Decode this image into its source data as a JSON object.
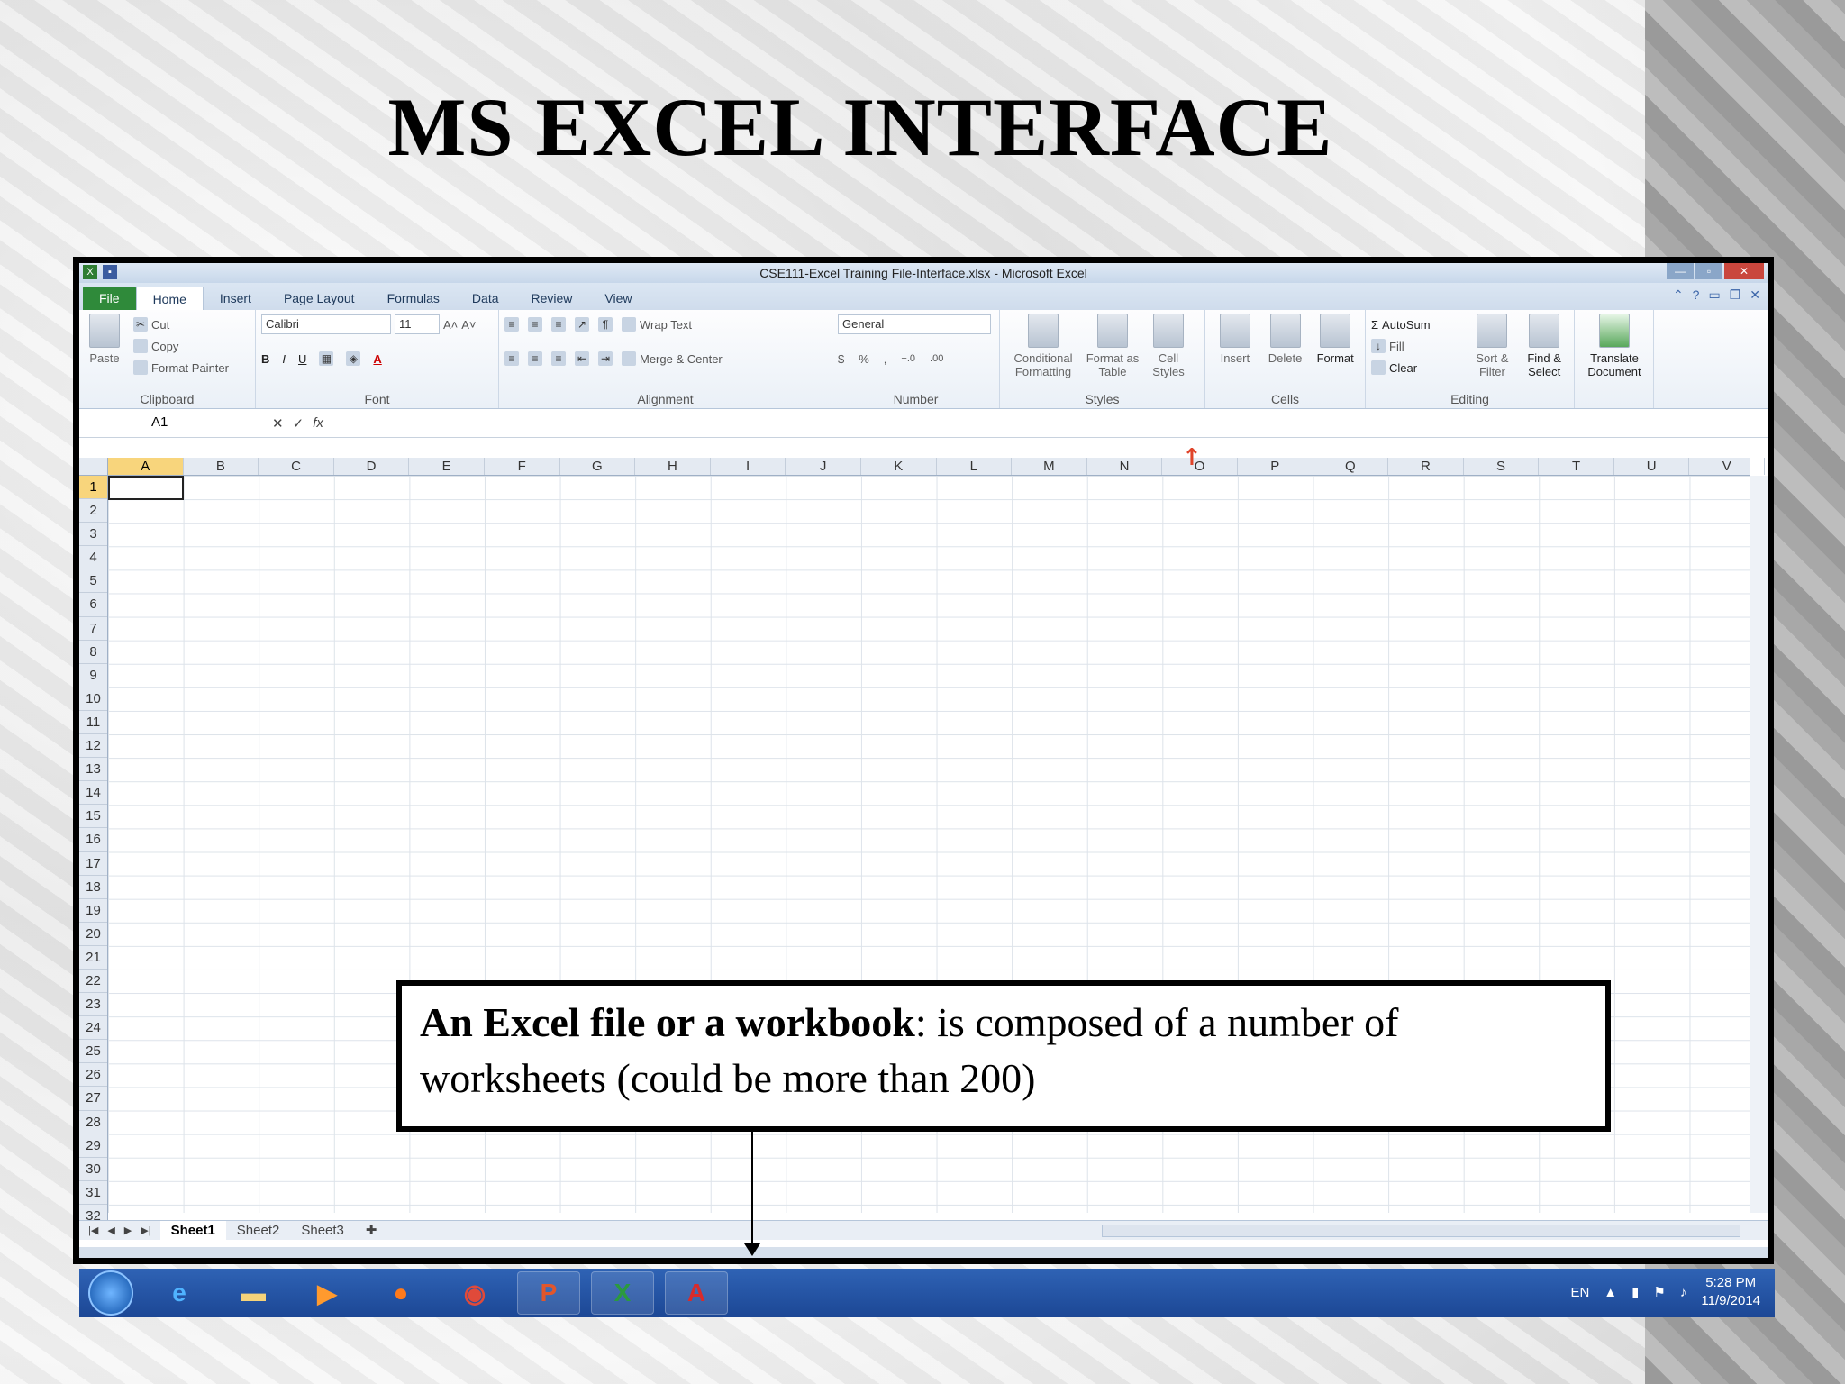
{
  "slide": {
    "title": "MS EXCEL INTERFACE",
    "callout_bold": "An Excel file or a workbook",
    "callout_rest": ": is composed of a number of worksheets (could be more than 200)"
  },
  "excel": {
    "window_title": "CSE111-Excel Training File-Interface.xlsx - Microsoft Excel",
    "tabs": [
      "File",
      "Home",
      "Insert",
      "Page Layout",
      "Formulas",
      "Data",
      "Review",
      "View"
    ],
    "active_tab": "Home",
    "clipboard": {
      "paste": "Paste",
      "cut": "Cut",
      "copy": "Copy",
      "format_painter": "Format Painter",
      "label": "Clipboard"
    },
    "font": {
      "name": "Calibri",
      "size": "11",
      "label": "Font"
    },
    "alignment": {
      "wrap_text": "Wrap Text",
      "merge_center": "Merge & Center",
      "label": "Alignment"
    },
    "number": {
      "format": "General",
      "label": "Number"
    },
    "styles": {
      "conditional": "Conditional Formatting",
      "format_table": "Format as Table",
      "cell_styles": "Cell Styles",
      "label": "Styles"
    },
    "cells": {
      "insert": "Insert",
      "delete": "Delete",
      "format": "Format",
      "label": "Cells"
    },
    "editing": {
      "autosum": "AutoSum",
      "fill": "Fill",
      "clear": "Clear",
      "sort_filter": "Sort & Filter",
      "find_select": "Find & Select",
      "label": "Editing"
    },
    "translate": "Translate Document",
    "name_box": "A1",
    "columns": [
      "A",
      "B",
      "C",
      "D",
      "E",
      "F",
      "G",
      "H",
      "I",
      "J",
      "K",
      "L",
      "M",
      "N",
      "O",
      "P",
      "Q",
      "R",
      "S",
      "T",
      "U",
      "V"
    ],
    "rows": [
      "1",
      "2",
      "3",
      "4",
      "5",
      "6",
      "7",
      "8",
      "9",
      "10",
      "11",
      "12",
      "13",
      "14",
      "15",
      "16",
      "17",
      "18",
      "19",
      "20",
      "21",
      "22",
      "23",
      "24",
      "25",
      "26",
      "27",
      "28",
      "29",
      "30",
      "31",
      "32"
    ],
    "sheets": [
      "Sheet1",
      "Sheet2",
      "Sheet3"
    ],
    "active_sheet": "Sheet1"
  },
  "taskbar": {
    "lang": "EN",
    "time": "5:28 PM",
    "date": "11/9/2014"
  }
}
